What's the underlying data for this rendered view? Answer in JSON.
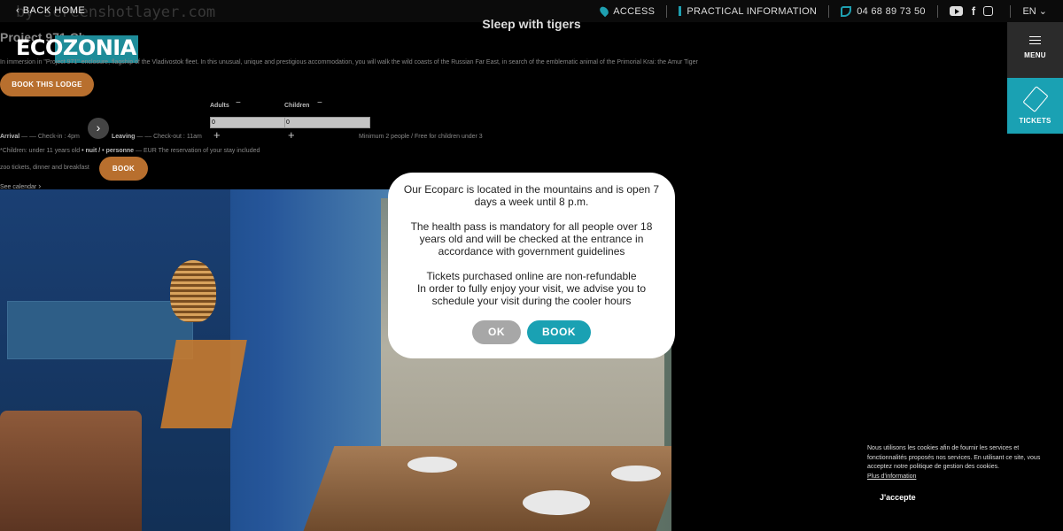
{
  "topbar": {
    "watermark": "by screenshotlayer.com",
    "back_label": "‹ BACK HOME",
    "nav": [
      {
        "label": "ACCESS",
        "icon": "map-pin-icon"
      },
      {
        "label": "PRACTICAL INFORMATION",
        "icon": "info-icon"
      },
      {
        "label": "04 68 89 73 50",
        "icon": "phone-icon"
      }
    ],
    "social_icons": [
      "youtube-icon",
      "facebook-icon",
      "instagram-icon"
    ],
    "facebook_glyph": "f",
    "language": "EN ⌄"
  },
  "side": {
    "menu_label": "MENU",
    "tickets_label": "TICKETS"
  },
  "page": {
    "title": "Sleep with tigers",
    "logo_text": "ECOZONIA",
    "lodge_title": "Project 971 Ch...",
    "intro": "In immersion in \"Project 971\" enclosure, flagship of the Vladivostok fleet. In this unusual, unique and prestigious accommodation, you will walk the wild coasts of the Russian Far East, in search of the emblematic animal of the Primorial Krai: the Amur Tiger",
    "book_lodge_label": "BOOK THIS LODGE"
  },
  "booking": {
    "adults_label": "Adults",
    "children_label": "Children",
    "minus": "−",
    "plus": "+",
    "adults_value": "0",
    "children_value": "0",
    "arrow": "›",
    "arrival_label": "Arrival",
    "arrival_text": "— –– Check-in : 4pm",
    "leaving_label": "Leaving",
    "leaving_text": "— –– Check-out : 11am",
    "minimum_text": "Minimum 2 people / Free for children under 3",
    "children_note": "*Children: under 11 years old",
    "night_text": "• nuit / • personne",
    "eur_text": "— EUR",
    "reservation_text": "The reservation of your stay included",
    "included_text": "zoo tickets, dinner and breakfast",
    "book_label": "BOOK",
    "see_calendar": "See calendar"
  },
  "modal": {
    "paragraphs": [
      "Our Ecoparc is located in the mountains and is open 7 days a week until 8 p.m.",
      "The health pass is mandatory for all people over 18 years old and will be checked at the entrance in accordance with government guidelines",
      "Tickets purchased online are non-refundable"
    ],
    "last_line": "In order to fully enjoy your visit, we advise you to schedule your visit during the cooler hours",
    "ok_label": "OK",
    "book_label": "BOOK"
  },
  "cookie": {
    "text": "Nous utilisons les cookies afin de fournir les services et fonctionnalités proposés nos services. En utilisant ce site, vous acceptez notre politique de gestion des cookies.",
    "more_link": "Plus d'information",
    "accept_label": "J'accepte"
  },
  "colors": {
    "accent": "#1aa1b3",
    "orange": "#b86f2e",
    "menu_bg": "#2b2b2b"
  }
}
